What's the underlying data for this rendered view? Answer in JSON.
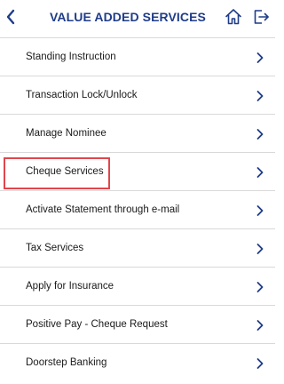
{
  "header": {
    "title": "VALUE ADDED SERVICES",
    "back_icon": "chevron-left-icon",
    "home_icon": "home-icon",
    "logout_icon": "logout-icon",
    "accent_color": "#1f3c88"
  },
  "menu": {
    "items": [
      {
        "label": "Standing Instruction"
      },
      {
        "label": "Transaction Lock/Unlock"
      },
      {
        "label": "Manage Nominee"
      },
      {
        "label": "Cheque Services"
      },
      {
        "label": "Activate Statement through e-mail"
      },
      {
        "label": "Tax Services"
      },
      {
        "label": "Apply for Insurance"
      },
      {
        "label": "Positive Pay - Cheque Request"
      },
      {
        "label": "Doorstep Banking"
      }
    ],
    "chevron_icon": "chevron-right-icon",
    "highlighted_item": "Cheque Services",
    "highlight_color": "#e0474c"
  }
}
